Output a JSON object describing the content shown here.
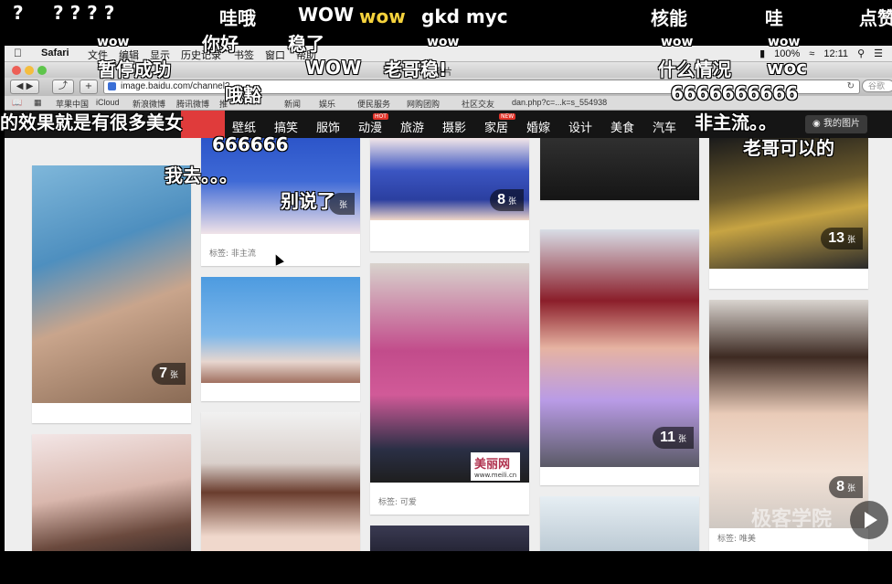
{
  "menubar": {
    "apple": "",
    "app": "Safari",
    "menus": [
      "文件",
      "编辑",
      "显示",
      "历史记录",
      "书签",
      "窗口",
      "帮助"
    ],
    "battery": "100%",
    "time": "12:11"
  },
  "browser": {
    "title": "图片",
    "url": "image.baidu.com/channel?...",
    "search_placeholder": "谷歌",
    "bookmarks": [
      "苹果中国",
      "iCloud",
      "新浪微博",
      "腾讯微博",
      "推",
      "新闻",
      "娱乐",
      "便民服务",
      "网购团购",
      "社区交友",
      "dan.php?c=...k=s_554938"
    ]
  },
  "nav": {
    "categories": [
      "壁纸",
      "搞笑",
      "服饰",
      "动漫",
      "旅游",
      "摄影",
      "家居",
      "婚嫁",
      "设计",
      "美食",
      "汽车"
    ],
    "hot_badge": "HOT",
    "new_badge": "NEW",
    "my_pictures": "我的图片"
  },
  "cards": [
    {
      "count": "7",
      "unit": "张"
    },
    {
      "count": "",
      "unit": "张",
      "tag": "标签: 非主流"
    },
    {
      "count": "8",
      "unit": "张"
    },
    {
      "count": "13",
      "unit": "张"
    },
    {
      "count": "11",
      "unit": "张"
    },
    {
      "count": "8",
      "unit": "张",
      "tag": "标签: 唯美"
    },
    {
      "tag": "标签: 可爱",
      "watermark": "美丽网",
      "watermark_url": "www.meili.cn"
    }
  ],
  "overlay": {
    "watermark": "极客学院"
  },
  "danmaku": [
    {
      "text": "?",
      "style": "big"
    },
    {
      "text": "? ? ? ?",
      "style": "big"
    },
    {
      "text": "哇哦",
      "style": "big"
    },
    {
      "text": "WOW",
      "style": "big"
    },
    {
      "text": "wow",
      "style": "big yellow"
    },
    {
      "text": "gkd myc",
      "style": "big"
    },
    {
      "text": "核能",
      "style": "big"
    },
    {
      "text": "哇",
      "style": "big"
    },
    {
      "text": "点赞",
      "style": "big"
    },
    {
      "text": "wow",
      "style": "small"
    },
    {
      "text": "你好",
      "style": "big"
    },
    {
      "text": "稳了",
      "style": "big"
    },
    {
      "text": "wow",
      "style": "small"
    },
    {
      "text": "wow",
      "style": "small"
    },
    {
      "text": "wow",
      "style": "small"
    },
    {
      "text": "暂停成功",
      "style": "big"
    },
    {
      "text": "WOW",
      "style": "big"
    },
    {
      "text": "老哥稳!",
      "style": "big"
    },
    {
      "text": "什么情况",
      "style": "big"
    },
    {
      "text": "woc",
      "style": "big"
    },
    {
      "text": "哦豁",
      "style": "big"
    },
    {
      "text": "6666666666",
      "style": "big"
    },
    {
      "text": "的效果就是有很多美女",
      "style": "big"
    },
    {
      "text": "非主流。。",
      "style": "big"
    },
    {
      "text": "666666",
      "style": "big"
    },
    {
      "text": "老哥可以的",
      "style": "big"
    },
    {
      "text": "我去。。。",
      "style": "big"
    },
    {
      "text": "别说了",
      "style": "big"
    }
  ]
}
